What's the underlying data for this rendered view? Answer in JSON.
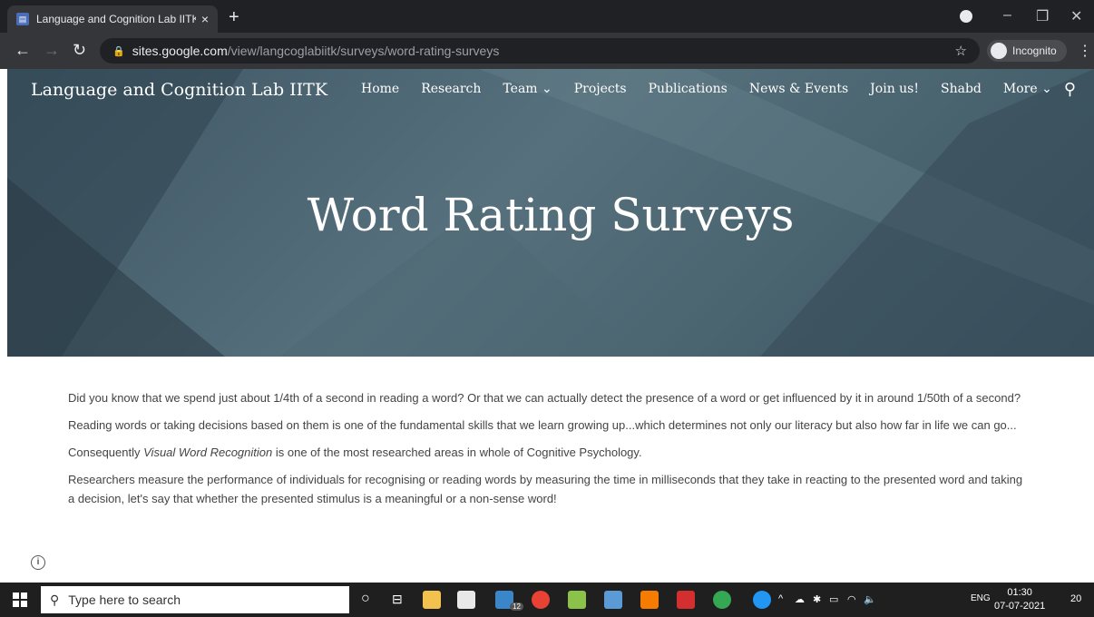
{
  "browser": {
    "tab_title": "Language and Cognition Lab IITK",
    "tab_close": "×",
    "new_tab": "+",
    "url_host": "sites.google.com",
    "url_path": "/view/langcoglabiitk/surveys/word-rating-surveys",
    "incognito_label": "Incognito",
    "window_controls": {
      "minimize": "–",
      "restore": "❐",
      "close": "✕"
    }
  },
  "site": {
    "title": "Language and Cognition Lab IITK",
    "nav": [
      "Home",
      "Research",
      "Team ⌄",
      "Projects",
      "Publications",
      "News & Events",
      "Join us!",
      "Shabd",
      "More ⌄"
    ],
    "hero_title": "Word Rating Surveys"
  },
  "content": {
    "p1": "Did you know that we spend just about 1/4th of a second in reading a word? Or that we can actually detect the presence of a word or get influenced by it in around 1/50th of a second?",
    "p2": "Reading words or taking decisions based on them is one of the fundamental skills that we learn growing up...which determines not only our literacy but also how far in life we can go...",
    "p3_pre": "Consequently ",
    "p3_em": "Visual Word Recognition",
    "p3_post": " is one of the most researched areas in whole of Cognitive Psychology.",
    "p4": "Researchers measure the performance of individuals for recognising or reading words by measuring the time in milliseconds that they take in reacting to the presented word and taking a decision, let's say that whether the presented stimulus is a meaningful or a non-sense word!"
  },
  "taskbar": {
    "search_placeholder": "Type here to search",
    "lang": "ENG",
    "time": "01:30",
    "date": "07-07-2021",
    "mail_badge": "12",
    "notif_count": "20"
  },
  "colors": {
    "hero_bg": "#4a6470",
    "chrome_dark": "#202124",
    "chrome_toolbar": "#35363a",
    "body_text": "#444444"
  }
}
